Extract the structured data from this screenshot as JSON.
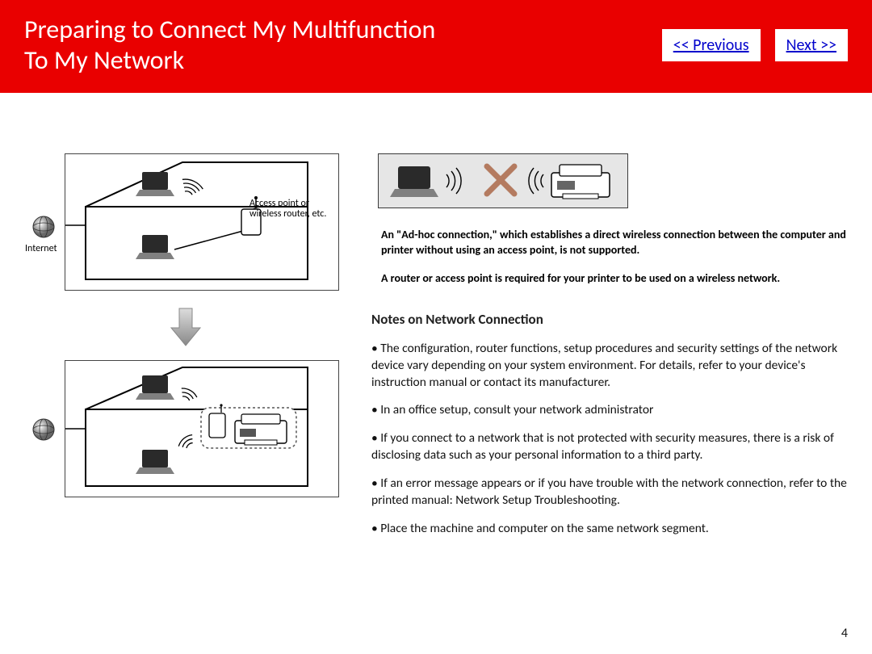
{
  "header": {
    "title_line1": "Preparing to Connect My Multifunction",
    "title_line2": "To My Network",
    "prev_label": "<< Previous",
    "next_label": "Next >>"
  },
  "left": {
    "ap_label": "Access point or wireless router, etc.",
    "internet_label": "Internet"
  },
  "right": {
    "bold_note1": "An \"Ad-hoc connection,\" which establishes a direct wireless connection between the computer and printer without using an access point, is not supported.",
    "bold_note2": "A router or  access point is required for your printer to be used on a wireless network.",
    "section_title": "Notes on Network Connection",
    "bullets": {
      "b1": "• The configuration, router functions, setup procedures and security settings of the network device vary depending on your system environment. For details, refer to your device's instruction manual or contact its manufacturer.",
      "b2": "• In an office setup, consult your network administrator",
      "b3": "• If you connect to a network that is not protected with security measures, there is a risk of disclosing data such as your personal information to a third party.",
      "b4": "• If an error message appears or if you have trouble with the network connection, refer to the printed manual: Network Setup Troubleshooting.",
      "b5": "• Place the machine and computer on the same network segment."
    }
  },
  "page_number": "4"
}
